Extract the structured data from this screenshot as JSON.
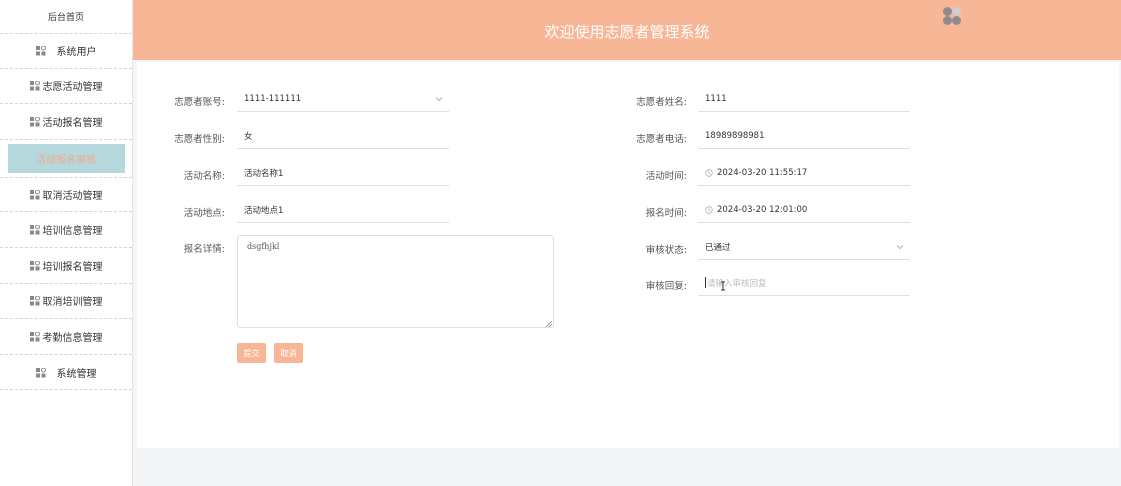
{
  "header": {
    "title": "欢迎使用志愿者管理系统"
  },
  "sidebar": {
    "home": "后台首页",
    "items": [
      {
        "label": "系统用户",
        "icon": "app-grid-icon"
      },
      {
        "label": "志愿活动管理",
        "icon": "app-grid-icon"
      },
      {
        "label": "活动报名管理",
        "icon": "app-grid-icon"
      },
      {
        "label": "活动报名审核",
        "icon": "app-grid-icon",
        "active": true
      },
      {
        "label": "取消活动管理",
        "icon": "app-grid-icon"
      },
      {
        "label": "培训信息管理",
        "icon": "app-grid-icon"
      },
      {
        "label": "培训报名管理",
        "icon": "app-grid-icon"
      },
      {
        "label": "取消培训管理",
        "icon": "app-grid-icon"
      },
      {
        "label": "考勤信息管理",
        "icon": "app-grid-icon"
      },
      {
        "label": "系统管理",
        "icon": "app-grid-icon"
      }
    ]
  },
  "form": {
    "account_label": "志愿者账号:",
    "account_value": "1111-111111",
    "name_label": "志愿者姓名:",
    "name_value": "1111",
    "gender_label": "志愿者性别:",
    "gender_value": "女",
    "phone_label": "志愿者电话:",
    "phone_value": "18989898981",
    "activity_name_label": "活动名称:",
    "activity_name_value": "活动名称1",
    "activity_time_label": "活动时间:",
    "activity_time_value": "2024-03-20 11:55:17",
    "activity_place_label": "活动地点:",
    "activity_place_value": "活动地点1",
    "signup_time_label": "报名时间:",
    "signup_time_value": "2024-03-20 12:01:00",
    "detail_label": "报名详情:",
    "detail_value": "dsgfhjkl",
    "review_status_label": "审核状态:",
    "review_status_value": "已通过",
    "review_reply_label": "审核回复:",
    "review_reply_placeholder": "请输入审核回复",
    "submit_label": "提交",
    "cancel_label": "取消"
  },
  "colors": {
    "accent": "#f7b797",
    "active_bg": "#b4d8dc",
    "active_text": "#f4a98a"
  }
}
